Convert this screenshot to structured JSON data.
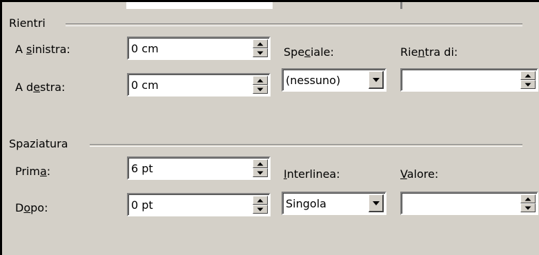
{
  "indent": {
    "group_label": "Rientri",
    "left": {
      "pre": "A ",
      "key": "s",
      "post": "inistra:",
      "value": "0 cm"
    },
    "right": {
      "pre": "A d",
      "key": "e",
      "post": "stra:",
      "value": "0 cm"
    },
    "special": {
      "pre": "Spe",
      "key": "c",
      "post": "iale:",
      "value": "(nessuno)"
    },
    "by": {
      "pre": "Rie",
      "key": "n",
      "post": "tra di:",
      "value": ""
    }
  },
  "spacing": {
    "group_label": "Spaziatura",
    "before": {
      "pre": "Prim",
      "key": "a",
      "post": ":",
      "value": "6 pt"
    },
    "after": {
      "pre": "D",
      "key": "o",
      "post": "po:",
      "value": "0 pt"
    },
    "line_spacing": {
      "pre": "",
      "key": "I",
      "post": "nterlinea:",
      "value": "Singola"
    },
    "at": {
      "pre": "",
      "key": "V",
      "post": "alore:",
      "value": ""
    }
  }
}
